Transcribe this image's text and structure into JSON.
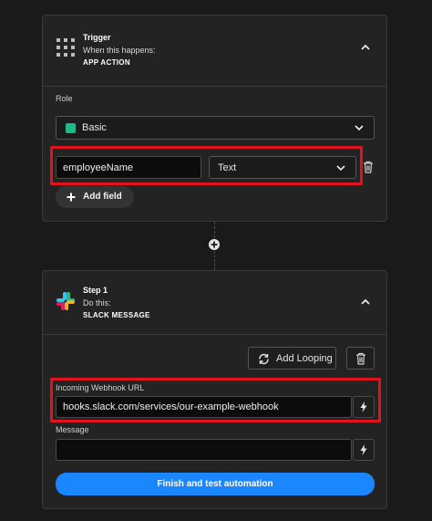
{
  "trigger": {
    "title": "Trigger",
    "subtitle": "When this happens:",
    "event": "APP ACTION",
    "role_label": "Role",
    "role_value": "Basic",
    "role_color": "#1fb88a",
    "field_name": "employeeName",
    "field_type": "Text",
    "add_field_label": "Add field"
  },
  "step": {
    "title": "Step 1",
    "subtitle": "Do this:",
    "action": "SLACK MESSAGE",
    "add_looping_label": "Add Looping",
    "webhook_label": "Incoming Webhook URL",
    "webhook_value": "hooks.slack.com/services/our-example-webhook",
    "message_label": "Message",
    "message_value": "",
    "finish_label": "Finish and test automation"
  },
  "colors": {
    "highlight": "#e0131f",
    "primary": "#1a86ff"
  }
}
